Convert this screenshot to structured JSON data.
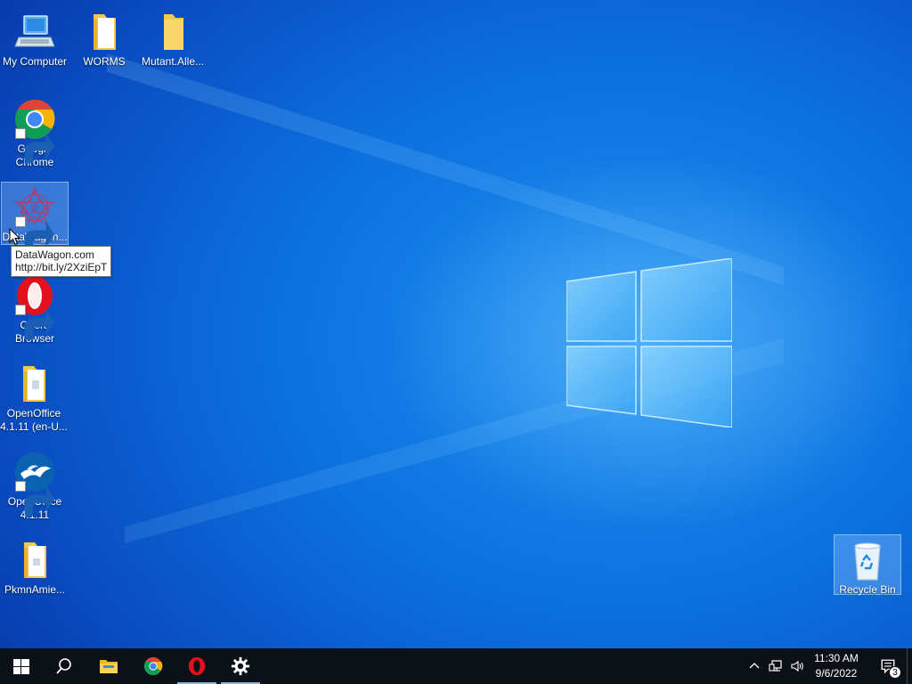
{
  "desktop": {
    "icons": [
      {
        "label": "My Computer",
        "icon": "computer-icon"
      },
      {
        "label": "WORMS",
        "icon": "folder-icon"
      },
      {
        "label": "Mutant.Alle...",
        "icon": "folder-icon"
      },
      {
        "label": "Google Chrome",
        "icon": "chrome-icon",
        "shortcut": true
      },
      {
        "label": "DataWagon...",
        "icon": "datawagon-icon",
        "shortcut": true,
        "selected": true
      },
      {
        "label": "Opera Browser",
        "icon": "opera-icon",
        "shortcut": true
      },
      {
        "label": "OpenOffice 4.1.11 (en-U...",
        "icon": "folder-icon"
      },
      {
        "label": "OpenOffice 4.1.11",
        "icon": "openoffice-icon",
        "shortcut": true
      },
      {
        "label": "PkmnAmie...",
        "icon": "folder-icon"
      },
      {
        "label": "Recycle Bin",
        "icon": "recycle-bin-icon",
        "selected": true
      }
    ],
    "tooltip": {
      "line1": "DataWagon.com",
      "line2": "http://bit.ly/2XziEpT"
    }
  },
  "taskbar": {
    "buttons": [
      {
        "name": "start",
        "icon": "windows-start-icon"
      },
      {
        "name": "search",
        "icon": "search-icon"
      },
      {
        "name": "file-explorer",
        "icon": "folder-icon"
      },
      {
        "name": "chrome",
        "icon": "chrome-icon"
      },
      {
        "name": "opera",
        "icon": "opera-icon",
        "running": true
      },
      {
        "name": "settings",
        "icon": "gear-icon",
        "running": true
      }
    ],
    "tray": {
      "time": "11:30 AM",
      "date": "9/6/2022",
      "notification_count": "3"
    }
  },
  "colors": {
    "taskbar": "#0c1118",
    "desktop_blue": "#0c6fde",
    "running_indicator": "#7fb8e6"
  }
}
